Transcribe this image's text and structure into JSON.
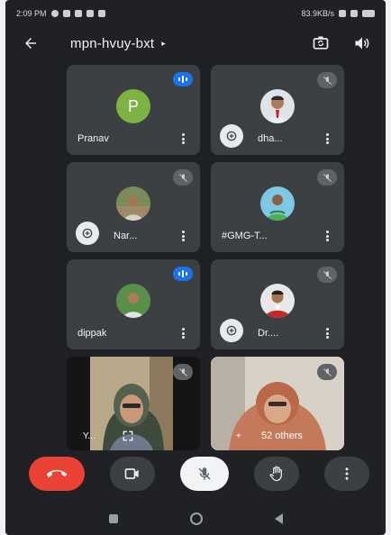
{
  "status_bar": {
    "time": "2:09 PM",
    "network_speed": "83.9KB/s",
    "battery": "100"
  },
  "header": {
    "meeting_code": "mpn-hvuy-bxt"
  },
  "participants": [
    {
      "name": "Pranav",
      "avatar_letter": "P",
      "avatar_color": "#7cb342",
      "status": "speaking"
    },
    {
      "name": "dha...",
      "status": "muted",
      "presenting": true
    },
    {
      "name": "Nar...",
      "status": "muted",
      "presenting": true
    },
    {
      "name": "#GMG-T...",
      "status": "muted"
    },
    {
      "name": "dippak",
      "status": "speaking"
    },
    {
      "name": "Dr....",
      "status": "muted",
      "presenting": true
    }
  ],
  "video_tiles": [
    {
      "name": "Y..."
    },
    {
      "name": "52 others",
      "prefix": "+"
    }
  ],
  "controls": {
    "end_call": "call-end-icon",
    "camera": "videocam-icon",
    "mic": "mic-off-icon",
    "hand": "raise-hand-icon",
    "more": "more-vert-icon"
  },
  "colors": {
    "background": "#202124",
    "tile": "#3c4043",
    "end_call": "#ea4335",
    "speaking": "#1a73e8"
  }
}
